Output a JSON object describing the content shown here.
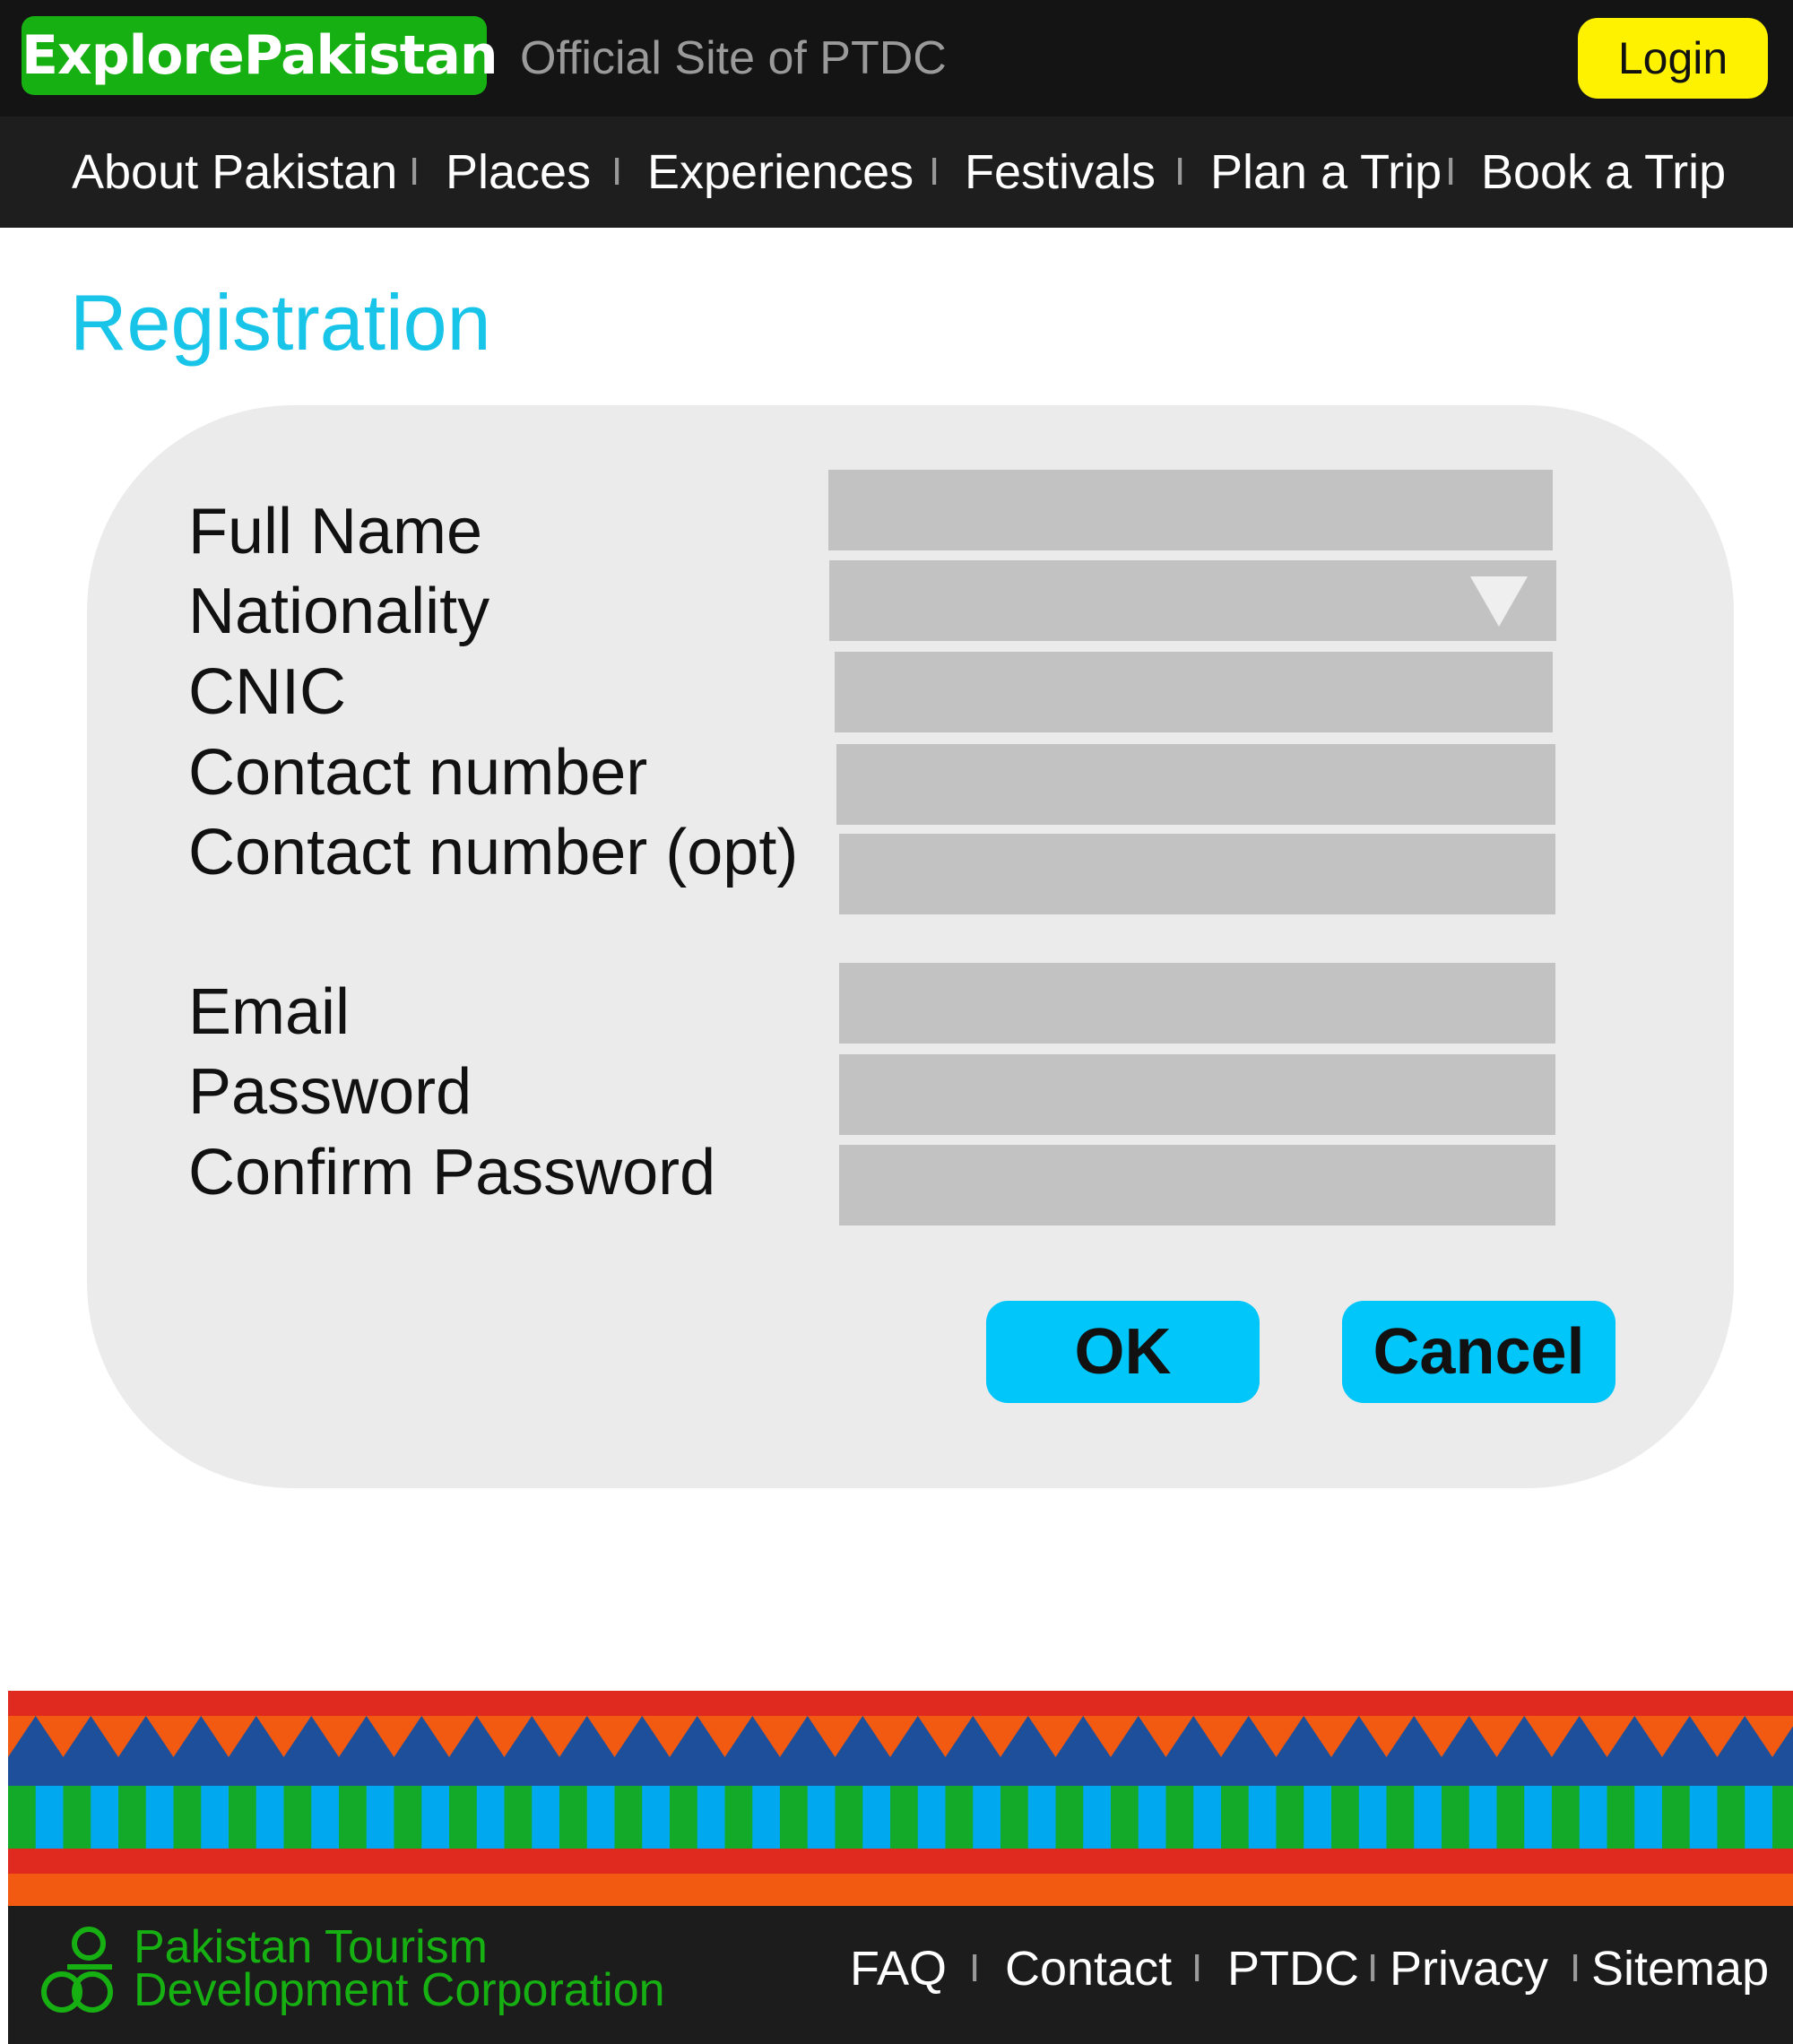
{
  "header": {
    "logo_text": "ExplorePakistan",
    "tagline": "Official Site of PTDC",
    "login_label": "Login"
  },
  "nav": {
    "items": [
      "About Pakistan",
      "Places",
      "Experiences",
      "Festivals",
      "Plan a Trip",
      "Book a Trip"
    ],
    "separator": "I"
  },
  "page": {
    "title": "Registration"
  },
  "form": {
    "fields": [
      {
        "label": "Full Name",
        "type": "text",
        "value": ""
      },
      {
        "label": "Nationality",
        "type": "select",
        "value": ""
      },
      {
        "label": "CNIC",
        "type": "text",
        "value": ""
      },
      {
        "label": "Contact number",
        "type": "text",
        "value": ""
      },
      {
        "label": "Contact number (opt)",
        "type": "text",
        "value": ""
      },
      {
        "label": "Email",
        "type": "text",
        "value": ""
      },
      {
        "label": "Password",
        "type": "password",
        "value": ""
      },
      {
        "label": "Confirm Password",
        "type": "password",
        "value": ""
      }
    ],
    "ok_label": "OK",
    "cancel_label": "Cancel"
  },
  "footer": {
    "org_line1": "Pakistan Tourism",
    "org_line2": "Development Corporation",
    "links": [
      "FAQ",
      "Contact",
      "PTDC",
      "Privacy",
      "Sitemap"
    ],
    "separator": "I"
  },
  "colors": {
    "brand_green": "#17b012",
    "accent_cyan": "#18c4e8",
    "button_cyan": "#00c6fa",
    "login_yellow": "#fff200",
    "band_red": "#e0291f",
    "band_orange": "#f25a12",
    "band_blue": "#1e4f9a",
    "band_light_blue": "#00a8ef",
    "band_green": "#13aa2a"
  },
  "icons": {
    "dropdown": "triangle-down-icon",
    "footer_logo": "ptdc-logo-icon"
  }
}
